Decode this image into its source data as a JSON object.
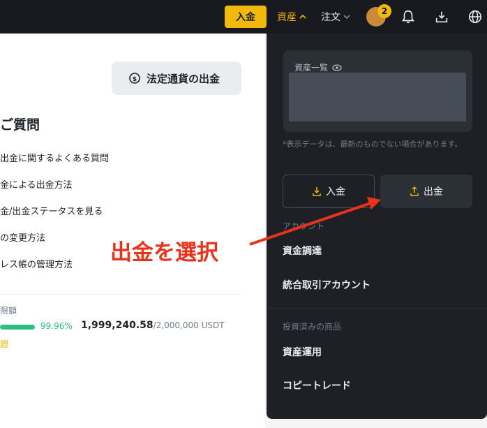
{
  "header": {
    "deposit_label": "入金",
    "assets_label": "資産",
    "orders_label": "注文",
    "notification_badge": "2",
    "accent": "#f0b90b"
  },
  "main": {
    "fiat_withdraw_label": "法定通貨の出金",
    "faq_title": "ご質問",
    "faq_items": [
      "出金に関するよくある質問",
      "金による出金方法",
      "金/出金ステータスを見る",
      "の変更方法",
      "レス帳の管理方法"
    ],
    "limit": {
      "label": "限額",
      "percent": "99.96%",
      "percent_value": 0.9996,
      "used": "1,999,240.58",
      "total": "/2,000,000 USDT",
      "mark": "題"
    }
  },
  "dropdown": {
    "overview_label": "資産一覧",
    "note": "*表示データは、最新のものでない場合があります。",
    "deposit_button": "入金",
    "withdraw_button": "出金",
    "account_section": "アカウント",
    "items_account": [
      "資金調達",
      "統合取引アカウント"
    ],
    "invested_section": "投資済みの商品",
    "items_invested": [
      "資産運用",
      "コピートレード"
    ]
  },
  "annotation": {
    "text": "出金を選択",
    "color": "#e8331c"
  },
  "icons": [
    "eye-icon",
    "bell-icon",
    "download-icon",
    "globe-icon",
    "coin-icon",
    "arrow-down-icon",
    "arrow-up-icon",
    "chevron-up-icon",
    "chevron-down-icon"
  ]
}
